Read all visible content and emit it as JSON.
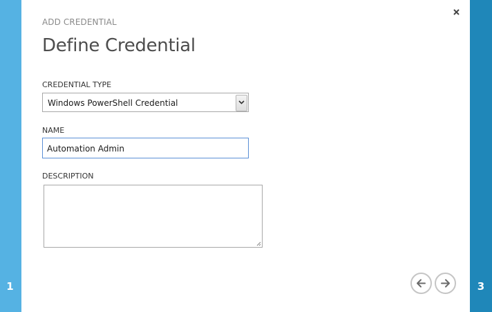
{
  "wizard": {
    "header": "ADD CREDENTIAL",
    "title": "Define Credential",
    "current_step": "1",
    "total_steps": "3",
    "close_icon": "close-icon",
    "back_icon": "arrow-left-icon",
    "next_icon": "arrow-right-icon"
  },
  "form": {
    "credential_type": {
      "label": "CREDENTIAL TYPE",
      "value": "Windows PowerShell Credential"
    },
    "name": {
      "label": "NAME",
      "value": "Automation Admin"
    },
    "description": {
      "label": "DESCRIPTION",
      "value": ""
    }
  },
  "colors": {
    "left_rail": "#55b2e3",
    "right_rail": "#1f87b9",
    "focus_border": "#5a8fd6",
    "nav_button_border": "#c5c5c5"
  }
}
